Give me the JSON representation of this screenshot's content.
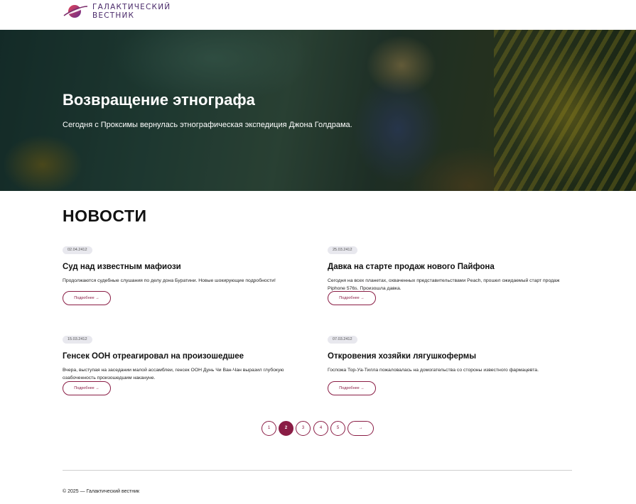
{
  "header": {
    "logo_line1": "ГАЛАКТИЧЕСКИЙ",
    "logo_line2": "ВЕСТНИК",
    "brand_color": "#8a1d45",
    "logo_icon": "planet-ring-icon"
  },
  "hero": {
    "title": "Возвращение этнографа",
    "subtitle": "Сегодня с Проксимы вернулась этнографическая экспедиция Джона Голдрама."
  },
  "news": {
    "heading": "НОВОСТИ",
    "items": [
      {
        "date": "02.04.2412",
        "title": "Суд над известным мафиози",
        "text": "Продолжаются судебные слушания по делу дона Буратини. Новые шокирующие подробности!",
        "more": "Подробнее →"
      },
      {
        "date": "25.03.2412",
        "title": "Давка на старте продаж нового Пайфона",
        "text": "Сегодня на всех планетах, охваченных представительствами Peach, прошел ожидаемый старт продаж Piphone 576s. Произошла давка.",
        "more": "Подробнее →"
      },
      {
        "date": "15.03.2412",
        "title": "Генсек ООН отреагировал на произошедшее",
        "text": "Вчера, выступая на заседании малой ассамблеи, генсек ООН Дунь Чи Ван-Чан выразил глубокую озабоченность произошедшим накануне.",
        "more": "Подробнее →"
      },
      {
        "date": "07.03.2412",
        "title": "Откровения хозяйки лягушкофермы",
        "text": "Госпожа Тор-Уа-Тилла пожаловалась на домогательства со стороны известного фармацевта.",
        "more": "Подробнее →"
      }
    ]
  },
  "pagination": {
    "pages": [
      "1",
      "2",
      "3",
      "4",
      "5"
    ],
    "current": "2",
    "next": "→"
  },
  "footer": {
    "copyright": "© 2025 — Галактический вестник"
  }
}
